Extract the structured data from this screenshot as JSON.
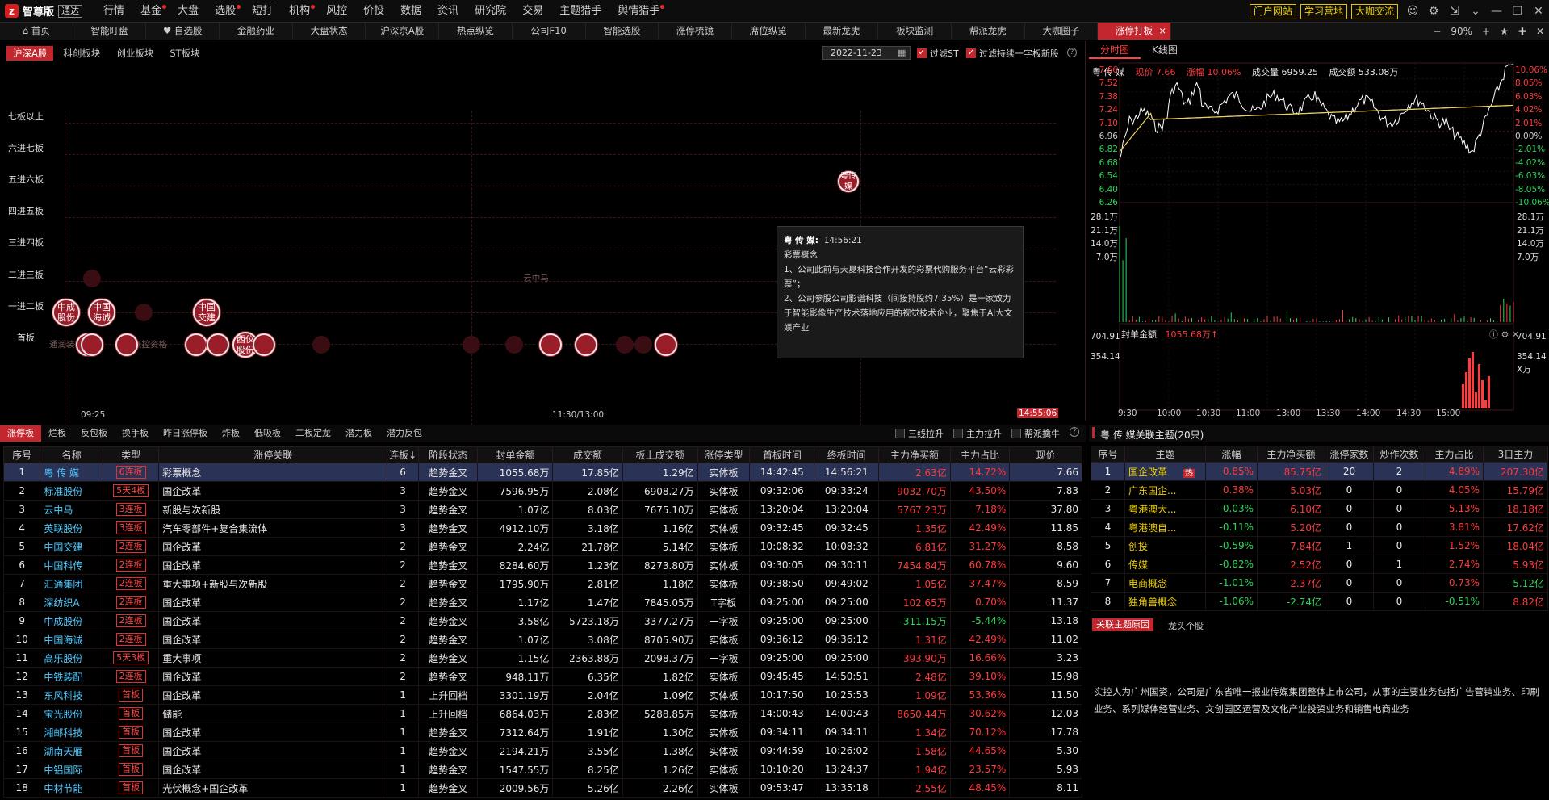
{
  "app": {
    "logo_mark": "z",
    "name": "智尊版",
    "badge": "通达"
  },
  "menu": [
    {
      "label": "行情",
      "dot": false
    },
    {
      "label": "基金",
      "dot": true
    },
    {
      "label": "大盘",
      "dot": false
    },
    {
      "label": "选股",
      "dot": true
    },
    {
      "label": "短打",
      "dot": false
    },
    {
      "label": "机构",
      "dot": true
    },
    {
      "label": "风控",
      "dot": false
    },
    {
      "label": "价投",
      "dot": false
    },
    {
      "label": "数据",
      "dot": false
    },
    {
      "label": "资讯",
      "dot": false
    },
    {
      "label": "研究院",
      "dot": false
    },
    {
      "label": "交易",
      "dot": false
    },
    {
      "label": "主题猎手",
      "dot": false
    },
    {
      "label": "舆情猎手",
      "dot": true
    }
  ],
  "top_buttons": [
    "门户网站",
    "学习营地",
    "大咖交流"
  ],
  "tabs": [
    "首页",
    "智能盯盘",
    "自选股",
    "金融药业",
    "大盘状态",
    "沪深京A股",
    "热点纵览",
    "公司F10",
    "智能选股",
    "涨停梳镜",
    "席位纵览",
    "最新龙虎",
    "板块监测",
    "帮派龙虎",
    "大咖圈子",
    "涨停打板"
  ],
  "active_tab": "涨停打板",
  "zoom": "90%",
  "board": {
    "subtabs": [
      "沪深A股",
      "科创板块",
      "创业板块",
      "ST板块"
    ],
    "date": "2022-11-23",
    "filter1": "过滤ST",
    "filter2": "过滤持续一字板新股",
    "levels": [
      "七板以上",
      "六进七板",
      "五进六板",
      "四进五板",
      "三进四板",
      "二进三板",
      "一进二板",
      "首板"
    ],
    "time_start": "09:25",
    "time_mid": "11:30/13:00",
    "time_end": "14:55:06",
    "bubble_labels": {
      "a": "中成股份",
      "b": "中国海诚",
      "c": "中国交建",
      "d": "西仪股份",
      "e": "粤传媒",
      "f": "云中马",
      "g": "通润装备",
      "h": "张控资格"
    },
    "tooltip": {
      "name": "粤 传 媒:",
      "time": "14:56:21",
      "concept": "彩票概念",
      "p1": "1、公司此前与天夏科技合作开发的彩票代购服务平台“云彩彩票”；",
      "p2": "2、公司参股公司影谱科技（间接持股约7.35%）是一家致力于智能影像生产技术落地应用的视觉技术企业，聚焦于AI大文娱产业"
    }
  },
  "bottom": {
    "tabs": [
      "涨停板",
      "烂板",
      "反包板",
      "换手板",
      "昨日涨停板",
      "炸板",
      "低吸板",
      "二板定龙",
      "潜力板",
      "潜力反包"
    ],
    "checks": [
      "三线拉升",
      "主力拉升",
      "帮派擒牛"
    ],
    "columns": [
      "序号",
      "名称",
      "类型",
      "涨停关联",
      "连板↓",
      "阶段状态",
      "封单金额",
      "成交额",
      "板上成交额",
      "涨停类型",
      "首板时间",
      "终板时间",
      "主力净买额",
      "主力占比",
      "现价"
    ],
    "rows": [
      [
        "1",
        "粤 传 媒",
        "6连板",
        "彩票概念",
        "6",
        "趋势金叉",
        "1055.68万",
        "17.85亿",
        "1.29亿",
        "实体板",
        "14:42:45",
        "14:56:21",
        "2.63亿",
        "14.72%",
        "7.66"
      ],
      [
        "2",
        "标准股份",
        "5天4板",
        "国企改革",
        "3",
        "趋势金叉",
        "7596.95万",
        "2.08亿",
        "6908.27万",
        "实体板",
        "09:32:06",
        "09:33:24",
        "9032.70万",
        "43.50%",
        "7.83"
      ],
      [
        "3",
        "云中马",
        "3连板",
        "新股与次新股",
        "3",
        "趋势金叉",
        "1.07亿",
        "8.03亿",
        "7675.10万",
        "实体板",
        "13:20:04",
        "13:20:04",
        "5767.23万",
        "7.18%",
        "37.80"
      ],
      [
        "4",
        "英联股份",
        "3连板",
        "汽车零部件+复合集流体",
        "3",
        "趋势金叉",
        "4912.10万",
        "3.18亿",
        "1.16亿",
        "实体板",
        "09:32:45",
        "09:32:45",
        "1.35亿",
        "42.49%",
        "11.85"
      ],
      [
        "5",
        "中国交建",
        "2连板",
        "国企改革",
        "2",
        "趋势金叉",
        "2.24亿",
        "21.78亿",
        "5.14亿",
        "实体板",
        "10:08:32",
        "10:08:32",
        "6.81亿",
        "31.27%",
        "8.58"
      ],
      [
        "6",
        "中国科传",
        "2连板",
        "国企改革",
        "2",
        "趋势金叉",
        "8284.60万",
        "1.23亿",
        "8273.80万",
        "实体板",
        "09:30:05",
        "09:30:11",
        "7454.84万",
        "60.78%",
        "9.60"
      ],
      [
        "7",
        "汇通集团",
        "2连板",
        "重大事项+新股与次新股",
        "2",
        "趋势金叉",
        "1795.90万",
        "2.81亿",
        "1.18亿",
        "实体板",
        "09:38:50",
        "09:49:02",
        "1.05亿",
        "37.47%",
        "8.59"
      ],
      [
        "8",
        "深纺织A",
        "2连板",
        "国企改革",
        "2",
        "趋势金叉",
        "1.17亿",
        "1.47亿",
        "7845.05万",
        "T字板",
        "09:25:00",
        "09:25:00",
        "102.65万",
        "0.70%",
        "11.37"
      ],
      [
        "9",
        "中成股份",
        "2连板",
        "国企改革",
        "2",
        "趋势金叉",
        "3.58亿",
        "5723.18万",
        "3377.27万",
        "一字板",
        "09:25:00",
        "09:25:00",
        "-311.15万",
        "-5.44%",
        "13.18"
      ],
      [
        "10",
        "中国海诚",
        "2连板",
        "国企改革",
        "2",
        "趋势金叉",
        "1.07亿",
        "3.08亿",
        "8705.90万",
        "实体板",
        "09:36:12",
        "09:36:12",
        "1.31亿",
        "42.49%",
        "11.02"
      ],
      [
        "11",
        "高乐股份",
        "5天3板",
        "重大事项",
        "2",
        "趋势金叉",
        "1.15亿",
        "2363.88万",
        "2098.37万",
        "一字板",
        "09:25:00",
        "09:25:00",
        "393.90万",
        "16.66%",
        "3.23"
      ],
      [
        "12",
        "中铁装配",
        "2连板",
        "国企改革",
        "2",
        "趋势金叉",
        "948.11万",
        "6.35亿",
        "1.82亿",
        "实体板",
        "09:45:45",
        "14:50:51",
        "2.48亿",
        "39.10%",
        "15.98"
      ],
      [
        "13",
        "东风科技",
        "首板",
        "国企改革",
        "1",
        "上升回档",
        "3301.19万",
        "2.04亿",
        "1.09亿",
        "实体板",
        "10:17:50",
        "10:25:53",
        "1.09亿",
        "53.36%",
        "11.50"
      ],
      [
        "14",
        "宝光股份",
        "首板",
        "储能",
        "1",
        "上升回档",
        "6864.03万",
        "2.83亿",
        "5288.85万",
        "实体板",
        "14:00:43",
        "14:00:43",
        "8650.44万",
        "30.62%",
        "12.03"
      ],
      [
        "15",
        "湘邮科技",
        "首板",
        "国企改革",
        "1",
        "趋势金叉",
        "7312.64万",
        "1.91亿",
        "1.30亿",
        "实体板",
        "09:34:11",
        "09:34:11",
        "1.34亿",
        "70.12%",
        "17.78"
      ],
      [
        "16",
        "湖南天雁",
        "首板",
        "国企改革",
        "1",
        "趋势金叉",
        "2194.21万",
        "3.55亿",
        "1.38亿",
        "实体板",
        "09:44:59",
        "10:26:02",
        "1.58亿",
        "44.65%",
        "5.30"
      ],
      [
        "17",
        "中铝国际",
        "首板",
        "国企改革",
        "1",
        "趋势金叉",
        "1547.55万",
        "8.25亿",
        "1.26亿",
        "实体板",
        "10:10:20",
        "13:24:37",
        "1.94亿",
        "23.57%",
        "5.93"
      ],
      [
        "18",
        "中材节能",
        "首板",
        "光伏概念+国企改革",
        "1",
        "趋势金叉",
        "2009.56万",
        "5.26亿",
        "2.26亿",
        "实体板",
        "09:53:47",
        "13:35:18",
        "2.55亿",
        "48.45%",
        "8.11"
      ]
    ]
  },
  "chart": {
    "tabs": [
      "分时图",
      "K线图"
    ],
    "info": {
      "name": "粤 传 媒",
      "price": "现价 7.66",
      "change": "涨幅 10.06%",
      "volume": "成交量 6959.25",
      "amount": "成交额 533.08万"
    },
    "price_ticks": [
      "7.66",
      "7.52",
      "7.38",
      "7.24",
      "7.10",
      "6.96",
      "6.82",
      "6.68",
      "6.54",
      "6.40",
      "6.26"
    ],
    "pct_ticks": [
      "10.06%",
      "8.05%",
      "6.03%",
      "4.02%",
      "2.01%",
      "0.00%",
      "-2.01%",
      "-4.02%",
      "-6.03%",
      "-8.05%",
      "-10.06%"
    ],
    "vol_ticks": [
      "28.1万",
      "21.1万",
      "14.0万",
      "7.0万"
    ],
    "seal_label": "封单金额",
    "seal_value": "1055.68万↑",
    "seal_ticks": [
      "704.91",
      "354.14"
    ],
    "seal_unit": "X万",
    "time_ticks": [
      "9:30",
      "10:00",
      "10:30",
      "11:00",
      "13:00",
      "13:30",
      "14:00",
      "14:30",
      "15:00"
    ],
    "colors": {
      "price": "#ffffff",
      "avg": "#e8d060",
      "up": "#ff3b3b",
      "down": "#2fd35a"
    }
  },
  "themes": {
    "title": "粤 传 媒关联主题(20只)",
    "columns": [
      "序号",
      "主题",
      "涨幅",
      "主力净买额",
      "涨停家数",
      "炒作次数",
      "主力占比",
      "3日主力"
    ],
    "rows": [
      [
        "1",
        "国企改革",
        "0.85%",
        "85.75亿",
        "20",
        "2",
        "4.89%",
        "207.30亿"
      ],
      [
        "2",
        "广东国企...",
        "0.38%",
        "5.03亿",
        "0",
        "0",
        "4.05%",
        "15.79亿"
      ],
      [
        "3",
        "粤港澳大...",
        "-0.03%",
        "6.10亿",
        "0",
        "0",
        "5.13%",
        "18.18亿"
      ],
      [
        "4",
        "粤港澳自...",
        "-0.11%",
        "5.20亿",
        "0",
        "0",
        "3.81%",
        "17.62亿"
      ],
      [
        "5",
        "创投",
        "-0.59%",
        "7.84亿",
        "1",
        "0",
        "1.52%",
        "18.04亿"
      ],
      [
        "6",
        "传媒",
        "-0.82%",
        "2.52亿",
        "0",
        "1",
        "2.74%",
        "5.93亿"
      ],
      [
        "7",
        "电商概念",
        "-1.01%",
        "2.37亿",
        "0",
        "0",
        "0.73%",
        "-5.12亿"
      ],
      [
        "8",
        "独角兽概念",
        "-1.06%",
        "-2.74亿",
        "0",
        "0",
        "-0.51%",
        "8.82亿"
      ]
    ],
    "hot_badge": "热",
    "reason_tabs": [
      "关联主题原因",
      "龙头个股"
    ],
    "reason_text": "实控人为广州国资，公司是广东省唯一报业传媒集团整体上市公司，从事的主要业务包括广告营销业务、印刷业务、系列媒体经营业务、文创园区运营及文化产业投资业务和销售电商业务"
  }
}
